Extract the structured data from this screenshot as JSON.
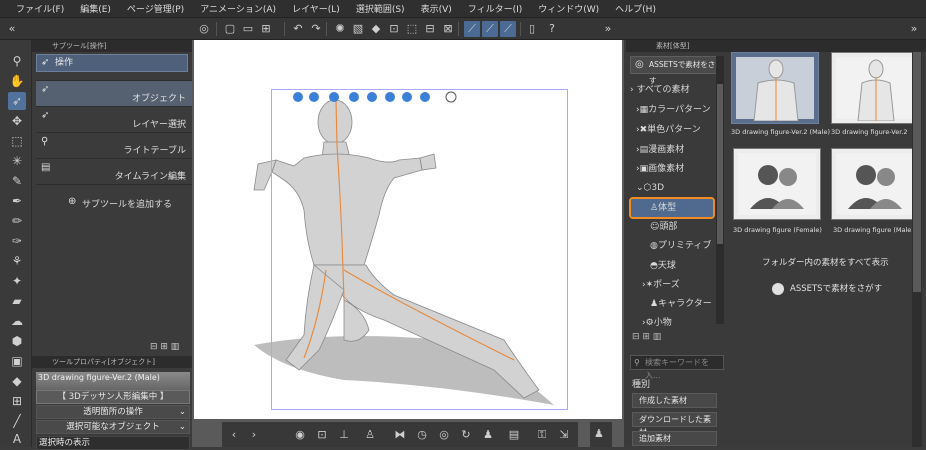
{
  "menu": [
    "ファイル(F)",
    "編集(E)",
    "ページ管理(P)",
    "アニメーション(A)",
    "レイヤー(L)",
    "選択範囲(S)",
    "表示(V)",
    "フィルター(I)",
    "ウィンドウ(W)",
    "ヘルプ(H)"
  ],
  "subtool_panel": {
    "tab": "サブツール[操作]",
    "group": "操作",
    "items": [
      {
        "label": "オブジェクト",
        "active": true
      },
      {
        "label": "レイヤー選択",
        "active": false
      },
      {
        "label": "ライトテーブル",
        "active": false
      },
      {
        "label": "タイムライン編集",
        "active": false
      }
    ],
    "add": "サブツールを追加する"
  },
  "tool_property": {
    "tab": "ツールプロパティ[オブジェクト]",
    "name": "3D drawing figure-Ver.2 (Male)",
    "edit_header": "【 3Dデッサン人形編集中 】",
    "rows": [
      "透明箇所の操作",
      "選択可能なオブジェクト"
    ],
    "bottom_label": "選択時の表示"
  },
  "material_panel": {
    "tab": "素材[体型]",
    "assets_button": "ASSETSで素材をさがす",
    "tree": [
      {
        "label": "すべての素材",
        "prefix": "›"
      },
      {
        "label": "カラーパターン",
        "prefix": "›"
      },
      {
        "label": "単色パターン",
        "prefix": "›"
      },
      {
        "label": "漫画素材",
        "prefix": "›"
      },
      {
        "label": "画像素材",
        "prefix": "›"
      },
      {
        "label": "3D",
        "prefix": "⌄"
      },
      {
        "label": "体型",
        "prefix": ""
      },
      {
        "label": "頭部",
        "prefix": ""
      },
      {
        "label": "プリミティブ",
        "prefix": ""
      },
      {
        "label": "天球",
        "prefix": ""
      },
      {
        "label": "ポーズ",
        "prefix": "›"
      },
      {
        "label": "キャラクター",
        "prefix": ""
      },
      {
        "label": "小物",
        "prefix": "›"
      }
    ],
    "thumbnails": [
      {
        "label": "3D drawing figure-Ver.2 (Male)",
        "selected": true
      },
      {
        "label": "3D drawing figure-Ver.2 (Fem",
        "selected": false
      },
      {
        "label": "3D drawing figure (Female)",
        "selected": false
      },
      {
        "label": "3D drawing figure (Male)",
        "selected": false
      }
    ],
    "folder_all": "フォルダー内の素材をすべて表示",
    "assets_link": "ASSETSで素材をさがす",
    "search_placeholder": "検索キーワードを入...",
    "kind_label": "種別",
    "kind_buttons": [
      "作成した素材",
      "ダウンロードした素材",
      "追加素材"
    ]
  },
  "colors": {
    "accent_blue": "#51729c",
    "highlight_orange": "#f08c23",
    "figure_guide": "#e8883a"
  }
}
